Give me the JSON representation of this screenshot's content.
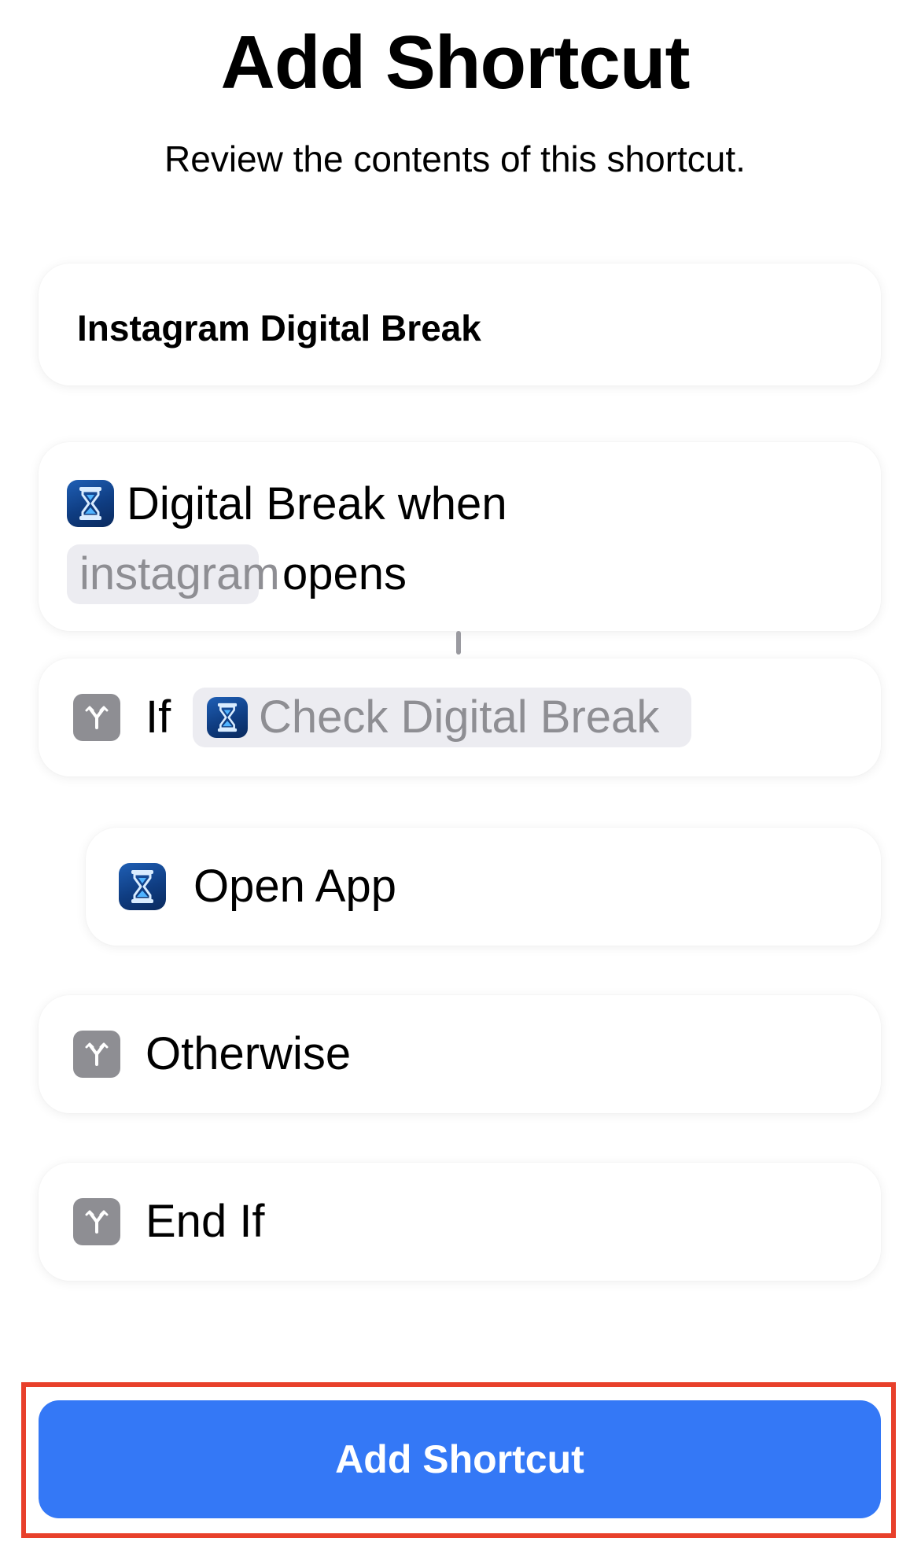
{
  "header": {
    "title": "Add Shortcut",
    "subtitle": "Review the contents of this shortcut."
  },
  "shortcut": {
    "name": "Instagram Digital Break"
  },
  "actions": {
    "trigger": {
      "icon": "hourglass-app-icon",
      "line1": "Digital Break when",
      "token": "instagram",
      "line2_suffix": "opens"
    },
    "if_row": {
      "icon": "scripting-branch-icon",
      "label": "If",
      "token_icon": "hourglass-app-icon",
      "token": "Check Digital Break"
    },
    "open_app": {
      "icon": "hourglass-app-icon",
      "label": "Open App"
    },
    "otherwise": {
      "icon": "scripting-branch-icon",
      "label": "Otherwise"
    },
    "end_if": {
      "icon": "scripting-branch-icon",
      "label": "End If"
    }
  },
  "footer": {
    "add_button_label": "Add Shortcut"
  },
  "colors": {
    "accent": "#3478f6",
    "highlight_outline": "#e8402b",
    "script_icon_bg": "#8e8e93",
    "token_bg": "#ececf1",
    "token_text": "#8e8e93"
  }
}
